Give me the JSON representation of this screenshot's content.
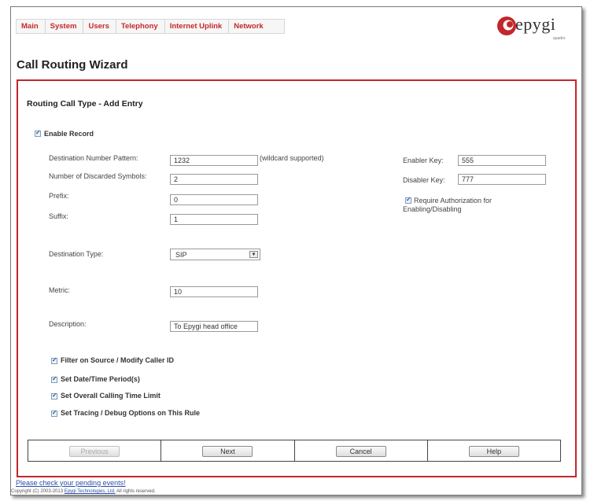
{
  "nav": {
    "items": [
      "Main",
      "System",
      "Users",
      "Telephony",
      "Internet Uplink",
      "Network"
    ]
  },
  "logo": {
    "brand": "epygi",
    "sub": "quadro"
  },
  "page_title": "Call Routing Wizard",
  "section_title": "Routing Call Type - Add Entry",
  "enable_record": {
    "label": "Enable Record",
    "checked": true
  },
  "fields": {
    "dest_pattern": {
      "label": "Destination Number Pattern:",
      "value": "1232",
      "hint": "(wildcard supported)"
    },
    "discarded": {
      "label": "Number of Discarded Symbols:",
      "value": "2"
    },
    "prefix": {
      "label": "Prefix:",
      "value": "0"
    },
    "suffix": {
      "label": "Suffix:",
      "value": "1"
    },
    "dest_type": {
      "label": "Destination Type:",
      "value": "SIP"
    },
    "metric": {
      "label": "Metric:",
      "value": "10"
    },
    "description": {
      "label": "Description:",
      "value": "To Epygi head office"
    },
    "enabler_key": {
      "label": "Enabler Key:",
      "value": "555"
    },
    "disabler_key": {
      "label": "Disabler Key:",
      "value": "777"
    },
    "require_auth": {
      "label_line1": "Require Authorization for",
      "label_line2": "Enabling/Disabling",
      "checked": true
    }
  },
  "options": [
    {
      "label": "Filter on Source / Modify Caller ID",
      "checked": true
    },
    {
      "label": "Set Date/Time Period(s)",
      "checked": true
    },
    {
      "label": "Set Overall Calling Time Limit",
      "checked": true
    },
    {
      "label": "Set Tracing / Debug Options on This Rule",
      "checked": true
    }
  ],
  "buttons": {
    "previous": "Previous",
    "next": "Next",
    "cancel": "Cancel",
    "help": "Help"
  },
  "footer": {
    "pending_link": "Please check your pending events!",
    "copyright_prefix": "Copyright (C) 2003-2013",
    "copyright_company": "Epygi Technologies, Ltd.",
    "copyright_suffix": "All rights reserved."
  },
  "colors": {
    "accent": "#c3262b",
    "link": "#2c4fa8"
  }
}
